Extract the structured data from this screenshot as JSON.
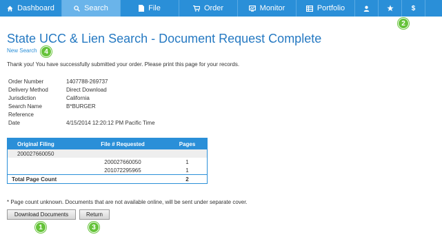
{
  "nav": {
    "items": [
      {
        "label": "Dashboard",
        "icon": "home-icon"
      },
      {
        "label": "Search",
        "icon": "search-icon",
        "active": true
      },
      {
        "label": "File",
        "icon": "file-icon"
      },
      {
        "label": "Order",
        "icon": "cart-icon"
      },
      {
        "label": "Monitor",
        "icon": "monitor-icon"
      },
      {
        "label": "Portfolio",
        "icon": "portfolio-icon"
      },
      {
        "label": "",
        "icon": "user-icon"
      },
      {
        "label": "",
        "icon": "star-icon"
      },
      {
        "label": "$",
        "icon": "dollar-icon"
      }
    ]
  },
  "colors": {
    "accent": "#2a8fd8",
    "active_tab": "#6ab4ea",
    "title": "#2579c2",
    "badge": "#66c33a"
  },
  "page": {
    "title": "State UCC & Lien Search - Document Request Complete",
    "new_search": "New Search",
    "thanks": "Thank you! You have successfully submitted your order. Please print this page for your records."
  },
  "details": [
    {
      "label": "Order Number",
      "value": "1407788-269737"
    },
    {
      "label": "Delivery Method",
      "value": "Direct Download"
    },
    {
      "label": "Jurisdiction",
      "value": "California"
    },
    {
      "label": "Search Name",
      "value": "B*BURGER"
    },
    {
      "label": "Reference",
      "value": ""
    },
    {
      "label": "Date",
      "value": "4/15/2014 12:20:12 PM Pacific Time"
    }
  ],
  "table": {
    "headers": [
      "Original Filing",
      "File # Requested",
      "Pages"
    ],
    "rows": [
      {
        "filing": "200027660050",
        "file": "",
        "pages": ""
      },
      {
        "filing": "",
        "file": "200027660050",
        "pages": "1"
      },
      {
        "filing": "",
        "file": "201072295965",
        "pages": "1"
      }
    ],
    "total_label": "Total Page Count",
    "total_pages": "2"
  },
  "footnote": "* Page count unknown. Documents that are not available online, will be sent under separate cover.",
  "buttons": {
    "download": "Download Documents",
    "return": "Return"
  },
  "badges": {
    "one": "1",
    "two": "2",
    "three": "3",
    "four": "4"
  }
}
